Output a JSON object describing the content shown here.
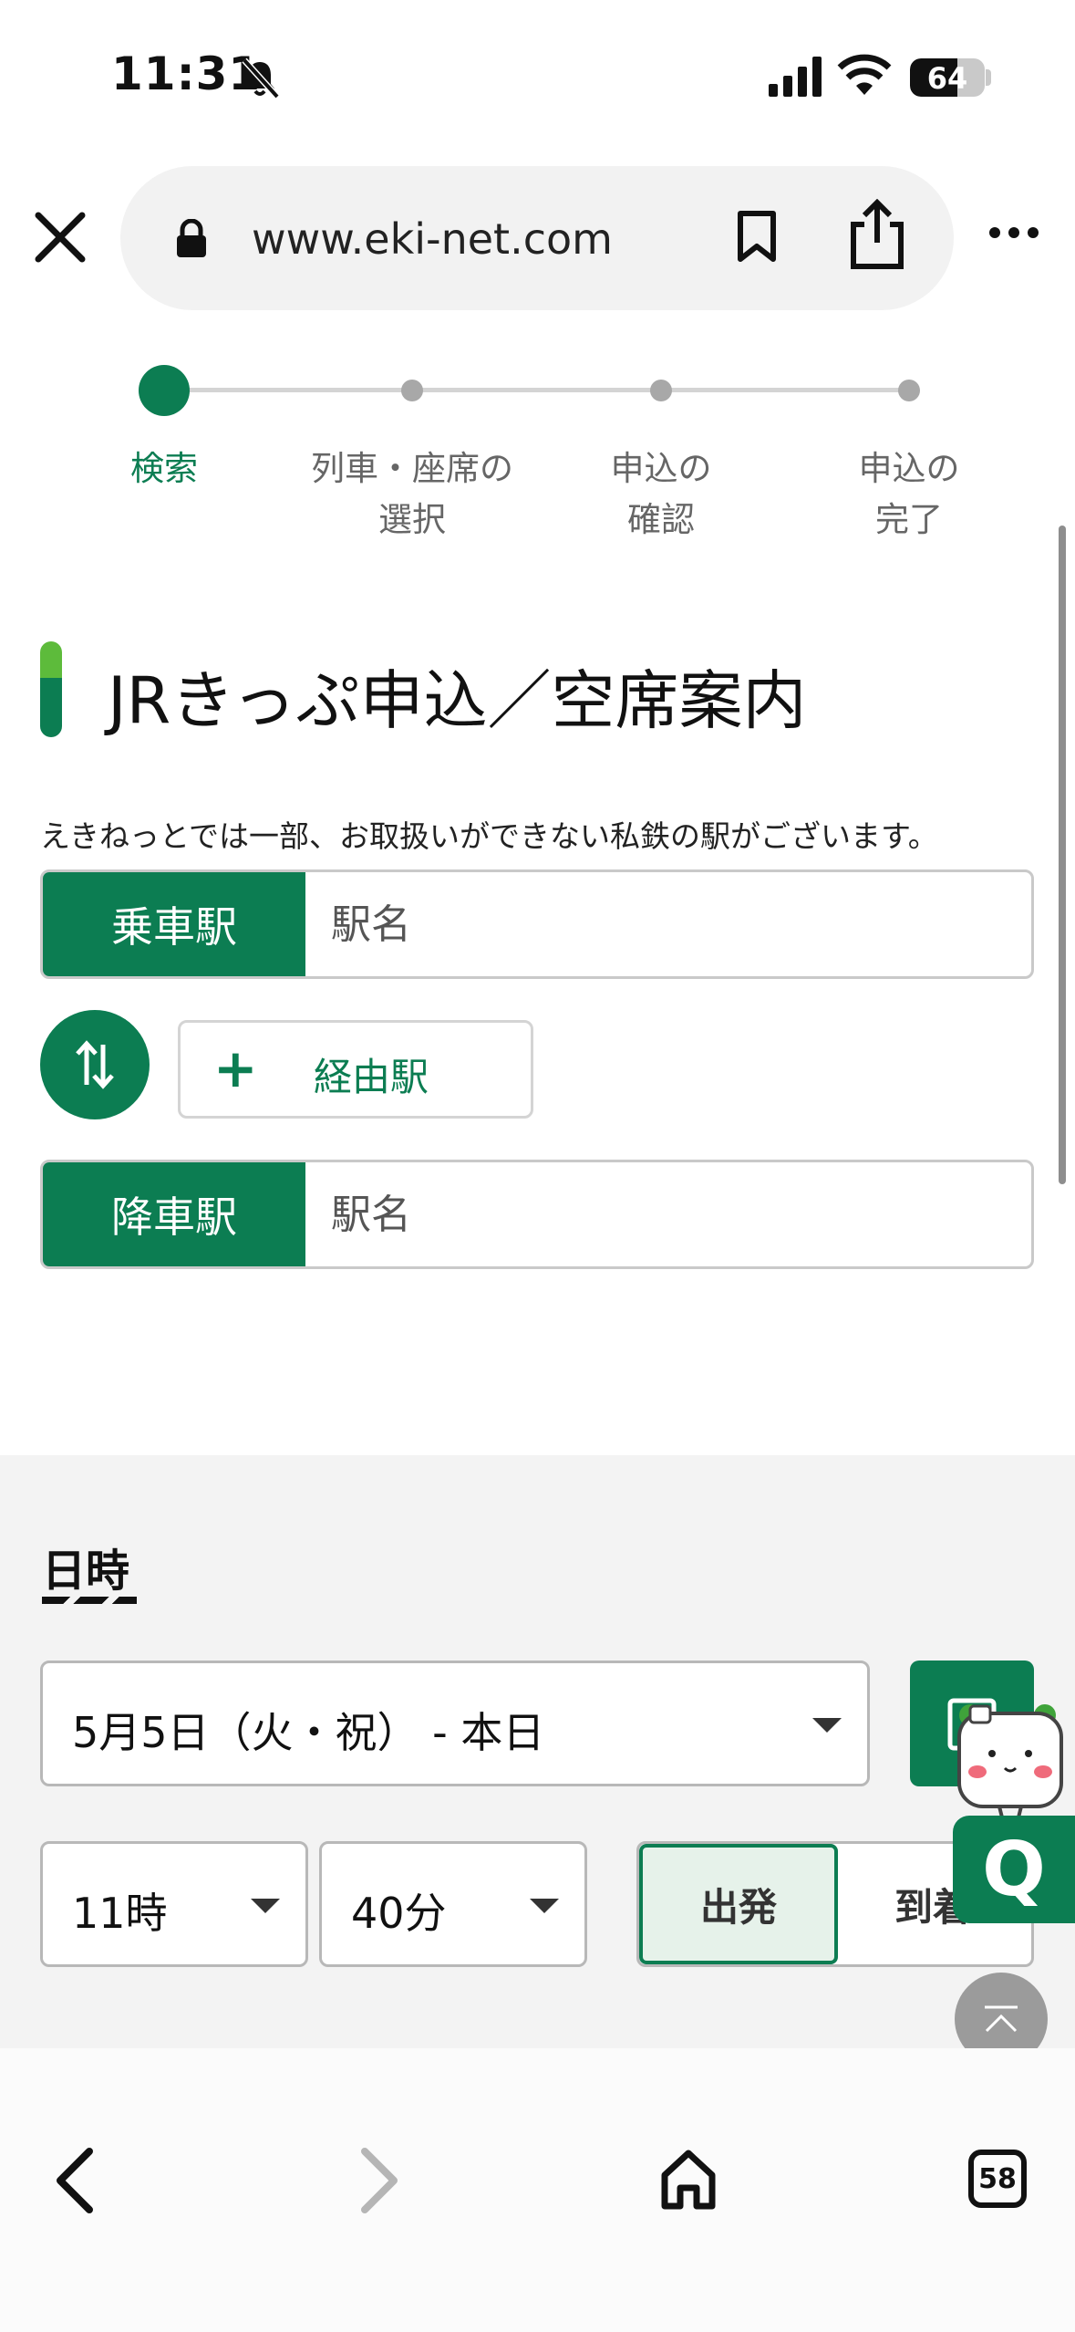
{
  "status_bar": {
    "time": "11:31",
    "battery_percent": "64"
  },
  "browser": {
    "url": "www.eki-net.com",
    "open_tabs": "58"
  },
  "stepper": {
    "steps": [
      {
        "label": "検索",
        "active": true
      },
      {
        "label": "列車・座席の\n選択",
        "active": false
      },
      {
        "label": "申込の\n確認",
        "active": false
      },
      {
        "label": "申込の\n完了",
        "active": false
      }
    ]
  },
  "page": {
    "title": "JRきっぷ申込／空席案内",
    "notice": "えきねっとでは一部、お取扱いができない私鉄の駅がございます。"
  },
  "stations": {
    "departure_label": "乗車駅",
    "departure_placeholder": "駅名",
    "via_label": "経由駅",
    "via_plus": "+",
    "arrival_label": "降車駅",
    "arrival_placeholder": "駅名"
  },
  "datetime": {
    "heading": "日時",
    "date_value": "5月5日（火・祝） - 本日",
    "hour_value": "11時",
    "minute_value": "40分",
    "depart_label": "出発",
    "arrive_label": "到着",
    "selected_mode": "出発"
  },
  "floating": {
    "q_label": "Q"
  },
  "colors": {
    "brand_green": "#0c7d52",
    "accent_light_green": "#5dbb3b"
  }
}
